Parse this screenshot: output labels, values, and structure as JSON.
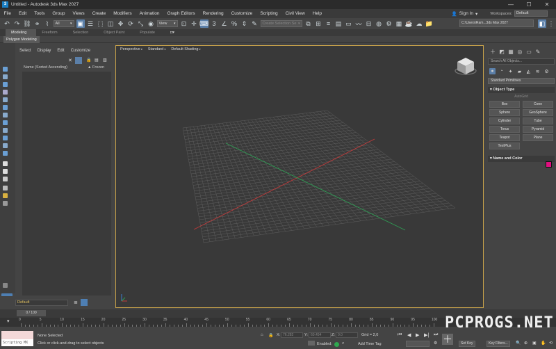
{
  "titlebar": {
    "app_icon": "3",
    "title": "Untitled - Autodesk 3ds Max 2027",
    "controls": [
      "—",
      "☐",
      "✕"
    ]
  },
  "menu": {
    "items": [
      "File",
      "Edit",
      "Tools",
      "Group",
      "Views",
      "Create",
      "Modifiers",
      "Animation",
      "Graph Editors",
      "Rendering",
      "Customize",
      "Scripting",
      "Civil View",
      "Help"
    ],
    "sign_in": "Sign In",
    "workspaces_label": "Workspaces:",
    "workspace_value": "Default"
  },
  "toolbar": {
    "selection_filter": "All",
    "coord_system": "View",
    "named_selection_placeholder": "Create Selection Se",
    "project_path": "C:\\Users\\Ram...3ds Max 2027"
  },
  "ribbon": {
    "tabs": [
      "Modeling",
      "Freeform",
      "Selection",
      "Object Paint",
      "Populate"
    ],
    "active_tab": "Modeling",
    "sub_label": "Polygon Modeling"
  },
  "scene_explorer": {
    "menu": [
      "Select",
      "Display",
      "Edit",
      "Customize"
    ],
    "col_name": "Name (Sorted Ascending)",
    "col_frozen": "▲ Frozen"
  },
  "viewport": {
    "labels": [
      "Perspective",
      "Standard",
      "Default Shading"
    ],
    "active_border_color": "#c8a24a"
  },
  "command_panel": {
    "search_placeholder": "Search All Objects...",
    "category": "Standard Primitives",
    "object_type_header": "Object Type",
    "autogrid": "AutoGrid",
    "objects": [
      "Box",
      "Cone",
      "Sphere",
      "GeoSphere",
      "Cylinder",
      "Tube",
      "Torus",
      "Pyramid",
      "Teapot",
      "Plane",
      "TextPlus"
    ],
    "name_color_header": "Name and Color",
    "swatch_color": "#e0107f"
  },
  "layer": {
    "current": "Default"
  },
  "timeline": {
    "frame_display": "0 / 100",
    "ticks": [
      "0",
      "5",
      "10",
      "15",
      "20",
      "25",
      "30",
      "35",
      "40",
      "45",
      "50",
      "55",
      "60",
      "65",
      "70",
      "75",
      "80",
      "85",
      "90",
      "95",
      "100"
    ]
  },
  "status": {
    "maxscript_label": "Scripting MX",
    "selection": "None Selected",
    "prompt": "Click or click-and-drag to select objects",
    "x_label": "X:",
    "y_label": "Y:",
    "z_label": "Z:",
    "x_value": "76.282",
    "y_value": "60.454",
    "z_value": "0.0",
    "grid": "Grid = 2,0",
    "enabled_label": "Enabled:",
    "add_time_tag": "Add Time Tag",
    "set_key": "Set Key",
    "key_filters": "Key Filters..."
  },
  "watermark": "PCPROGS.NET"
}
